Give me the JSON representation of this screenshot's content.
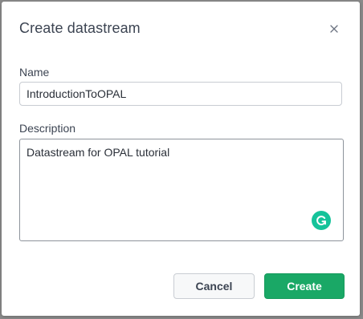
{
  "dialog": {
    "title": "Create datastream",
    "close_icon": "close-icon"
  },
  "fields": {
    "name_label": "Name",
    "name_value": "IntroductionToOPAL",
    "description_label": "Description",
    "description_value": "Datastream for OPAL tutorial"
  },
  "extension": {
    "icon": "grammarly-icon",
    "color": "#15c39a"
  },
  "buttons": {
    "cancel_label": "Cancel",
    "create_label": "Create"
  },
  "colors": {
    "primary": "#1aa866",
    "text": "#3c4452"
  }
}
